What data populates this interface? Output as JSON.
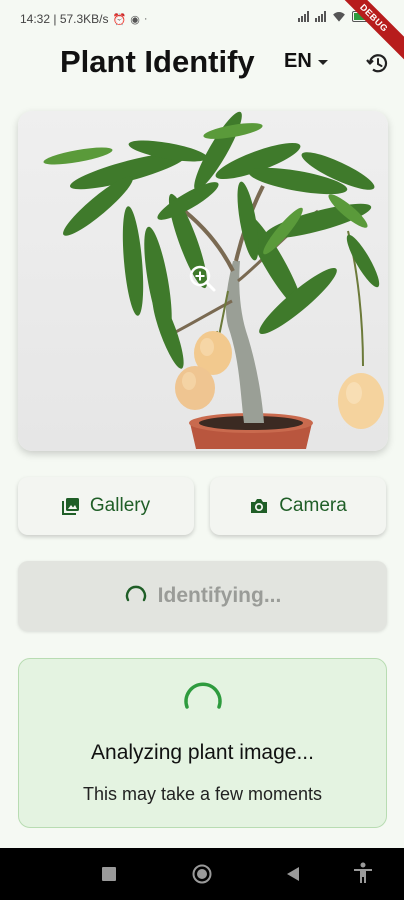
{
  "status_bar": {
    "time_speed": "14:32 | 57.3KB/s",
    "debug_banner": "DEBUG"
  },
  "header": {
    "title": "Plant Identify",
    "language": "EN"
  },
  "actions": {
    "gallery_label": "Gallery",
    "camera_label": "Camera",
    "identify_label": "Identifying..."
  },
  "analysis": {
    "title": "Analyzing plant image...",
    "subtitle": "This may take a few moments"
  },
  "colors": {
    "accent": "#1f5e27",
    "spinner": "#2e9b3e",
    "background": "#f5f9f3",
    "card": "#e4f3e1"
  }
}
